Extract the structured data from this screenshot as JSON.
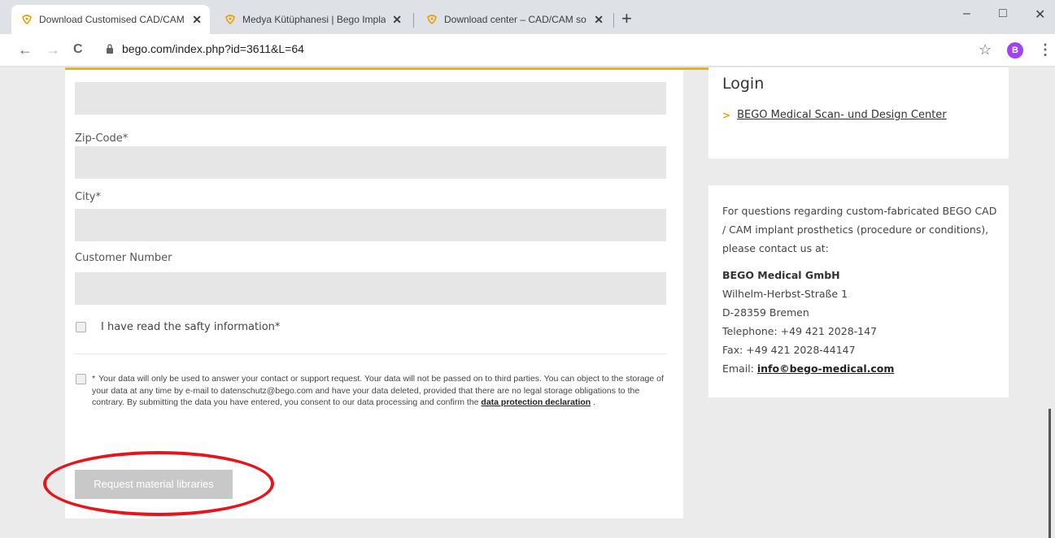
{
  "browser": {
    "tabs": [
      {
        "title": "Download Customised CAD/CAM",
        "close": "✕"
      },
      {
        "title": "Medya Kütüphanesi | Bego Impla",
        "close": "✕"
      },
      {
        "title": "Download center – CAD/CAM so",
        "close": "✕"
      }
    ],
    "new_tab": "+",
    "window_controls": {
      "minimize": "–",
      "maximize": "□",
      "close": "✕"
    },
    "nav": {
      "back": "←",
      "forward": "→",
      "reload": "C"
    },
    "url": "bego.com/index.php?id=3611&L=64",
    "star": "☆",
    "profile_initial": "B",
    "menu": "⋮"
  },
  "form": {
    "zip_label": "Zip-Code*",
    "city_label": "City*",
    "customer_label": "Customer Number",
    "safety_label": "I have read the safty information*",
    "privacy_text": "Your data will only be used to answer your contact or support request. Your data will not be passed on to third parties. You can object to the storage of your data at any time by e-mail to datenschutz@bego.com and have your data deleted, provided that there are no legal storage obligations to the contrary. By submitting the data you have entered, you consent to our data processing and confirm the",
    "privacy_link": "data protection declaration",
    "privacy_end": " .",
    "asterisk": "*",
    "submit_label": "Request material libraries"
  },
  "sidebar": {
    "login_title": "Login",
    "login_link": "BEGO Medical Scan- und Design Center",
    "contact_intro": "For questions regarding custom-fabricated BEGO CAD / CAM implant prosthetics (procedure or conditions), please contact us at:",
    "company": "BEGO Medical GmbH",
    "street": "Wilhelm-Herbst-Straße 1",
    "city": "D-28359 Bremen",
    "telephone": "Telephone: +49 421 2028-147",
    "fax": "Fax: +49 421 2028-44147",
    "email_label": "Email: ",
    "email": "info©bego-medical.com"
  },
  "colors": {
    "accent": "#f0b400",
    "highlight": "#e8141c",
    "profile": "#a142f4"
  }
}
